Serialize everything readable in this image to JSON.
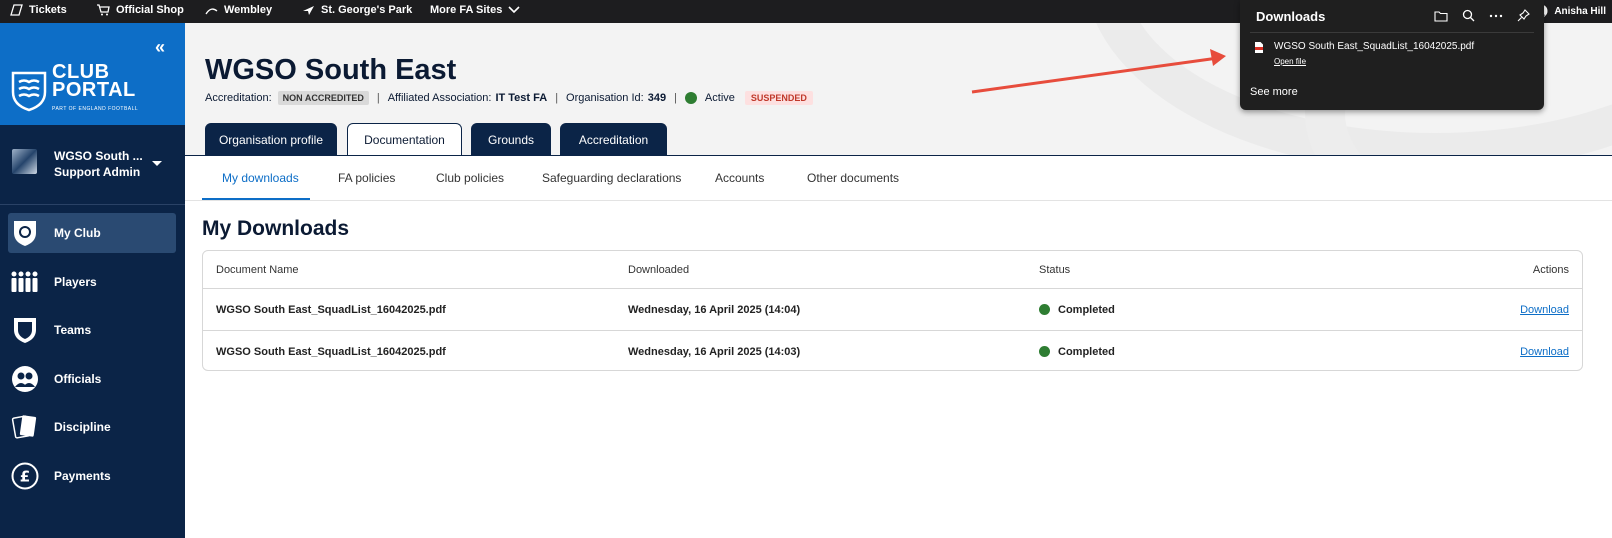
{
  "topbar": {
    "links": [
      "Tickets",
      "Official Shop",
      "Wembley",
      "St. George's Park",
      "More FA Sites"
    ],
    "user": "Anisha Hill"
  },
  "sidebar": {
    "logo": {
      "line1": "CLUB",
      "line2": "PORTAL",
      "tagline": "PART OF ENGLAND FOOTBALL"
    },
    "org": {
      "name": "WGSO South ...",
      "role": "Support Admin"
    },
    "items": [
      {
        "label": "My Club",
        "icon": "shield-icon",
        "active": true
      },
      {
        "label": "Players",
        "icon": "players-icon"
      },
      {
        "label": "Teams",
        "icon": "teams-icon"
      },
      {
        "label": "Officials",
        "icon": "officials-icon"
      },
      {
        "label": "Discipline",
        "icon": "discipline-icon"
      },
      {
        "label": "Payments",
        "icon": "pound-icon"
      }
    ]
  },
  "header": {
    "title": "WGSO South East",
    "accreditation_label": "Accreditation:",
    "accreditation_value": "NON ACCREDITED",
    "association_label": "Affiliated Association:",
    "association_value": "IT Test FA",
    "org_id_label": "Organisation Id:",
    "org_id_value": "349",
    "status": "Active",
    "status_color": "#2e7d32",
    "flag": "SUSPENDED"
  },
  "tabs": [
    "Organisation profile",
    "Documentation",
    "Grounds",
    "Accreditation"
  ],
  "active_tab": "Documentation",
  "subtabs": [
    "My downloads",
    "FA policies",
    "Club policies",
    "Safeguarding declarations",
    "Accounts",
    "Other documents"
  ],
  "active_subtab": "My downloads",
  "section_title": "My Downloads",
  "table": {
    "columns": [
      "Document Name",
      "Downloaded",
      "Status",
      "Actions"
    ],
    "rows": [
      {
        "name": "WGSO South East_SquadList_16042025.pdf",
        "downloaded": "Wednesday, 16 April 2025 (14:04)",
        "status": "Completed",
        "action": "Download"
      },
      {
        "name": "WGSO South East_SquadList_16042025.pdf",
        "downloaded": "Wednesday, 16 April 2025 (14:03)",
        "status": "Completed",
        "action": "Download"
      }
    ]
  },
  "downloads_panel": {
    "title": "Downloads",
    "file": "WGSO South East_SquadList_16042025.pdf",
    "open_file": "Open file",
    "see_more": "See more"
  },
  "colors": {
    "brand_blue": "#0d6ec7",
    "navy": "#0b2447",
    "annotation_arrow": "#e74c3c"
  }
}
